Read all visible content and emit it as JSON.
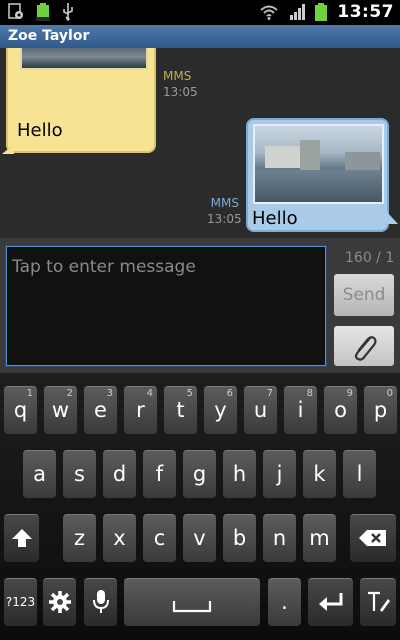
{
  "status_bar": {
    "time": "13:57",
    "left_icons": [
      "screenshot-icon",
      "battery-100-icon",
      "usb-icon"
    ],
    "right_icons": [
      "wifi-icon",
      "signal-icon",
      "battery-icon"
    ]
  },
  "header": {
    "title": "Zoe Taylor"
  },
  "conversation": {
    "messages": [
      {
        "direction": "incoming",
        "text": "Hello",
        "type": "MMS",
        "time": "13:05",
        "bubble_color": "#f6e394"
      },
      {
        "direction": "outgoing",
        "text": "Hello",
        "type": "MMS",
        "time": "13:05",
        "bubble_color": "#a9cbe9"
      }
    ]
  },
  "compose": {
    "placeholder": "Tap to enter message",
    "counter": "160 / 1",
    "send_label": "Send",
    "attach_icon": "paperclip-icon"
  },
  "keyboard": {
    "row1": [
      {
        "key": "q",
        "sub": "1"
      },
      {
        "key": "w",
        "sub": "2"
      },
      {
        "key": "e",
        "sub": "3"
      },
      {
        "key": "r",
        "sub": "4"
      },
      {
        "key": "t",
        "sub": "5"
      },
      {
        "key": "y",
        "sub": "6"
      },
      {
        "key": "u",
        "sub": "7"
      },
      {
        "key": "i",
        "sub": "8"
      },
      {
        "key": "o",
        "sub": "9"
      },
      {
        "key": "p",
        "sub": "0"
      }
    ],
    "row2": [
      "a",
      "s",
      "d",
      "f",
      "g",
      "h",
      "j",
      "k",
      "l"
    ],
    "row3": [
      "z",
      "x",
      "c",
      "v",
      "b",
      "n",
      "m"
    ],
    "numbers_label": "?123",
    "period_label": ".",
    "space_symbol": "␣",
    "accent_color": "#5a8fd6"
  }
}
